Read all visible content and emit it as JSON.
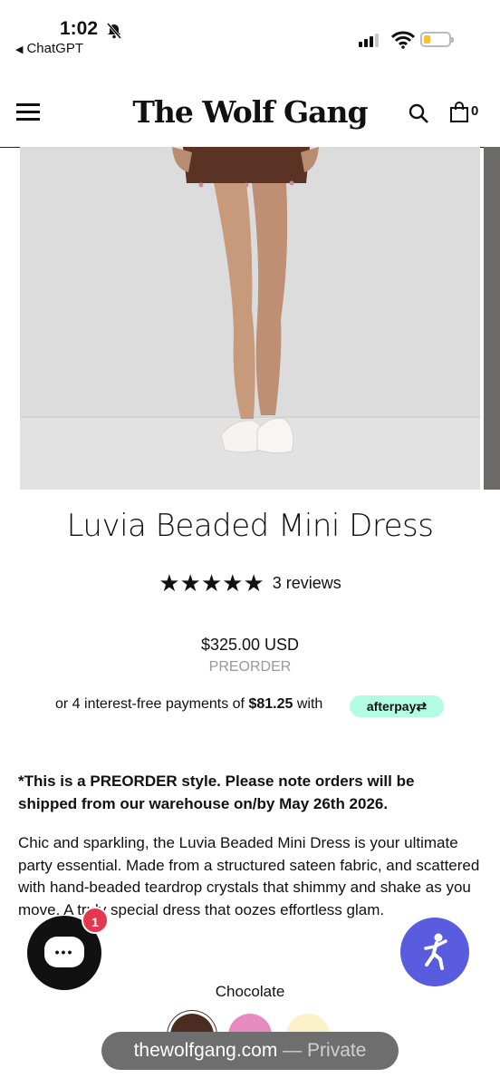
{
  "status_bar": {
    "time": "1:02",
    "back_app": "ChatGPT"
  },
  "header": {
    "logo": "The Wolf Gang",
    "cart_count": "0"
  },
  "product": {
    "title": "Luvia Beaded Mini Dress",
    "stars": "★★★★★",
    "rating_value": 5,
    "reviews": "3 reviews",
    "price": "$325.00 USD",
    "availability": "PREORDER",
    "installments_prefix": "or 4 interest-free payments of",
    "installment_amount": "$81.25",
    "installments_suffix": "with",
    "afterpay_label": "afterpay⇄",
    "notice": "*This is a PREORDER style. Please note orders will be shipped from our warehouse on/by May 26th 2026.",
    "description": "Chic and sparkling, the Luvia Beaded Mini Dress is your ultimate party essential. Made from a structured sateen fabric, and scattered with hand-beaded teardrop crystals that shimmy and shake as you move. A truly special dress that oozes effortless glam.",
    "color_label": "Chocolate",
    "swatches": [
      "#4a2c20",
      "#e68ac0",
      "#fbf2c8"
    ]
  },
  "chat": {
    "badge": "1",
    "dots": "•••"
  },
  "browser": {
    "domain": "thewolfgang.com",
    "mode": " — Private"
  },
  "colors": {
    "accessibility_button": "#5a5ce0",
    "chat_badge": "#e5384f",
    "afterpay": "#b2fce4"
  }
}
